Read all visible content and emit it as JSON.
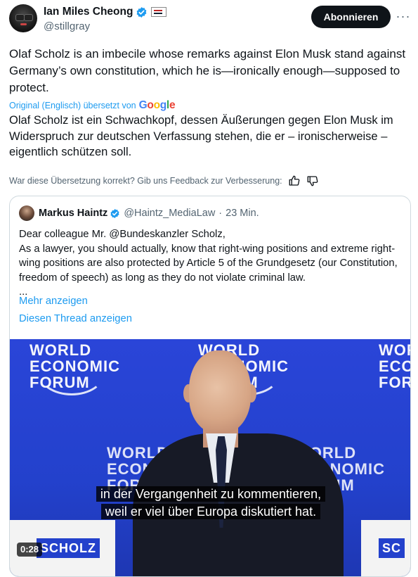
{
  "author": {
    "name": "Ian Miles Cheong",
    "handle": "@stillgray",
    "verified": true
  },
  "subscribe_label": "Abonnieren",
  "more_label": "···",
  "tweet": {
    "original_text": "Olaf Scholz is an imbecile whose remarks against Elon Musk stand against Germany’s own constitution, which he is—ironically enough—supposed to protect.",
    "translation_label": "Original (Englisch) übersetzt von",
    "translation_provider": "Google",
    "translated_text": "Olaf Scholz ist ein Schwachkopf, dessen Äußerungen gegen Elon Musk im Widerspruch zur deutschen Verfassung stehen, die er – ironischerweise – eigentlich schützen soll.",
    "feedback_prompt": "War diese Übersetzung korrekt? Gib uns Feedback zur Verbesserung:"
  },
  "quote": {
    "name": "Markus Haintz",
    "handle": "@Haintz_MediaLaw",
    "separator": "·",
    "time": "23 Min.",
    "text": "Dear colleague Mr. @Bundeskanzler Scholz,\nAs a lawyer, you should actually, know that right-wing positions and extreme right-wing positions are also protected by Article 5 of the Grundgesetz (our Constitution, freedom of speech) as long as they do not violate criminal law.\n...",
    "show_more": "Mehr anzeigen",
    "show_thread": "Diesen Thread anzeigen"
  },
  "video": {
    "backdrop_lines": [
      "WORLD",
      "ECONOMIC",
      "FORUM"
    ],
    "subtitle_line1": "in der Vergangenheit zu kommentieren,",
    "subtitle_line2": "weil er viel über Europa diskutiert hat.",
    "nameplate_left": "SCHOLZ",
    "nameplate_right": "SC",
    "duration": "0:28"
  },
  "colors": {
    "accent": "#1d9bf0",
    "text": "#0f1419",
    "muted": "#536471",
    "wef_blue": "#2341cc"
  }
}
